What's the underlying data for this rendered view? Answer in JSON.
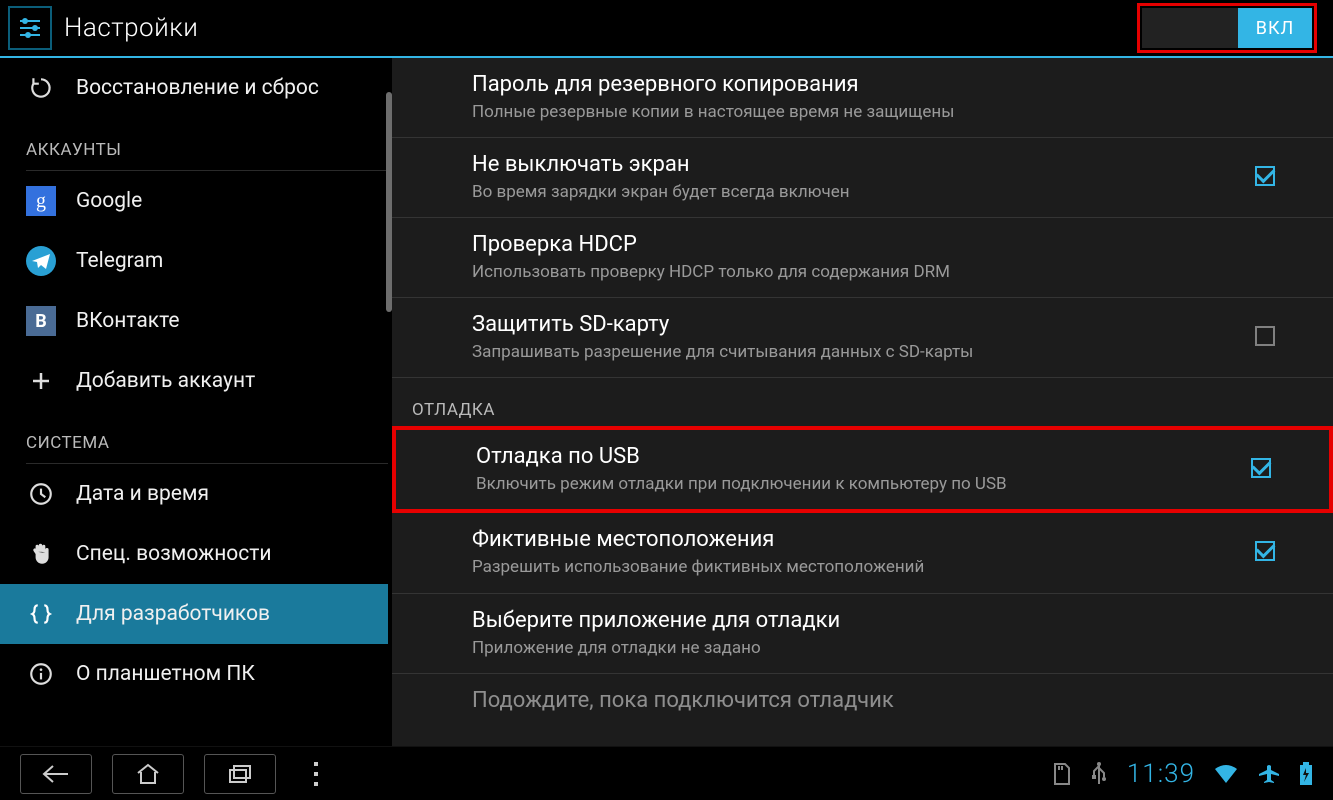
{
  "header": {
    "title": "Настройки",
    "toggle_on_label": "ВКЛ"
  },
  "sidebar": {
    "restore": "Восстановление и сброс",
    "section_accounts": "АККАУНТЫ",
    "google": "Google",
    "telegram": "Telegram",
    "vk": "ВКонтакте",
    "add_account": "Добавить аккаунт",
    "section_system": "СИСТЕМА",
    "date_time": "Дата и время",
    "accessibility": "Спец. возможности",
    "developer": "Для разработчиков",
    "about": "О планшетном ПК"
  },
  "content": {
    "backup_pw_title": "Пароль для резервного копирования",
    "backup_pw_sub": "Полные резервные копии в настоящее время не защищены",
    "stay_awake_title": "Не выключать экран",
    "stay_awake_sub": "Во время зарядки экран будет всегда включен",
    "hdcp_title": "Проверка HDCP",
    "hdcp_sub": "Использовать проверку HDCP только для содержания DRM",
    "sd_title": "Защитить SD-карту",
    "sd_sub": "Запрашивать разрешение для считывания данных с SD-карты",
    "section_debug": "ОТЛАДКА",
    "usb_title": "Отладка по USB",
    "usb_sub": "Включить режим отладки при подключении к компьютеру по USB",
    "mock_loc_title": "Фиктивные местоположения",
    "mock_loc_sub": "Разрешить использование фиктивных местоположений",
    "debug_app_title": "Выберите приложение для отладки",
    "debug_app_sub": "Приложение для отладки не задано",
    "wait_title": "Подождите, пока подключится отладчик"
  },
  "statusbar": {
    "time": "11:39"
  }
}
